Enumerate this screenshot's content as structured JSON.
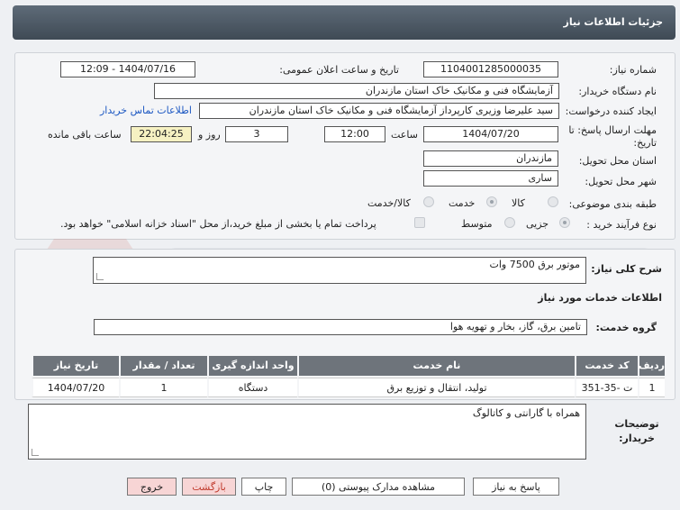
{
  "header": {
    "title": "جزئیات اطلاعات نیاز"
  },
  "fields": {
    "need_number_label": "شماره نیاز:",
    "need_number": "1104001285000035",
    "announce_label": "تاریخ و ساعت اعلان عمومی:",
    "announce_value": "1404/07/16 - 12:09",
    "buyer_org_label": "نام دستگاه خریدار:",
    "buyer_org": "آزمایشگاه فنی و مکانیک خاک استان مازندران",
    "creator_label": "ایجاد کننده درخواست:",
    "creator": "سید علیرضا  وزیری  کارپرداز آزمایشگاه فنی و مکانیک خاک استان مازندران",
    "contact_link": "اطلاعات تماس خریدار",
    "deadline_label": "مهلت ارسال پاسخ: تا تاریخ:",
    "deadline_date": "1404/07/20",
    "time_label": "ساعت",
    "deadline_time": "12:00",
    "days_value": "3",
    "days_label": "روز و",
    "remaining_time": "22:04:25",
    "remaining_label": "ساعت باقی مانده",
    "province_label": "استان محل تحویل:",
    "province": "مازندران",
    "city_label": "شهر محل تحویل:",
    "city": "ساری",
    "category_label": "طبقه بندی موضوعی:",
    "category_options": [
      "کالا",
      "خدمت",
      "کالا/خدمت"
    ],
    "process_label": "نوع فرآیند خرید :",
    "process_options": [
      "جزیی",
      "متوسط"
    ],
    "payment_note": "پرداخت تمام یا بخشی از مبلغ خرید،از محل \"اسناد خزانه اسلامی\" خواهد بود."
  },
  "summary": {
    "label": "شرح کلی نیاز:",
    "value": "موتور برق 7500 وات"
  },
  "services": {
    "section_title": "اطلاعات خدمات مورد نیاز",
    "group_label": "گروه خدمت:",
    "group_value": "تامین برق، گاز، بخار و تهویه هوا",
    "columns": [
      "ردیف",
      "کد خدمت",
      "نام خدمت",
      "واحد اندازه گیری",
      "تعداد / مقدار",
      "تاریخ نیاز"
    ],
    "rows": [
      [
        "1",
        "ت -35-351",
        "تولید، انتقال و توزیع برق",
        "دستگاه",
        "1",
        "1404/07/20"
      ]
    ]
  },
  "notes": {
    "label": "توضیحات خریدار:",
    "value": "همراه با گارانتی و کاتالوگ"
  },
  "buttons": {
    "reply": "پاسخ به نیاز",
    "docs": "مشاهده مدارک پیوستی (0)",
    "print": "چاپ",
    "back": "بازگشت",
    "exit": "خروج"
  },
  "colors": {
    "header": "#4a5561",
    "table_header": "#6e747b",
    "link": "#1d58c2",
    "remaining_bg": "#f6f1c2"
  }
}
